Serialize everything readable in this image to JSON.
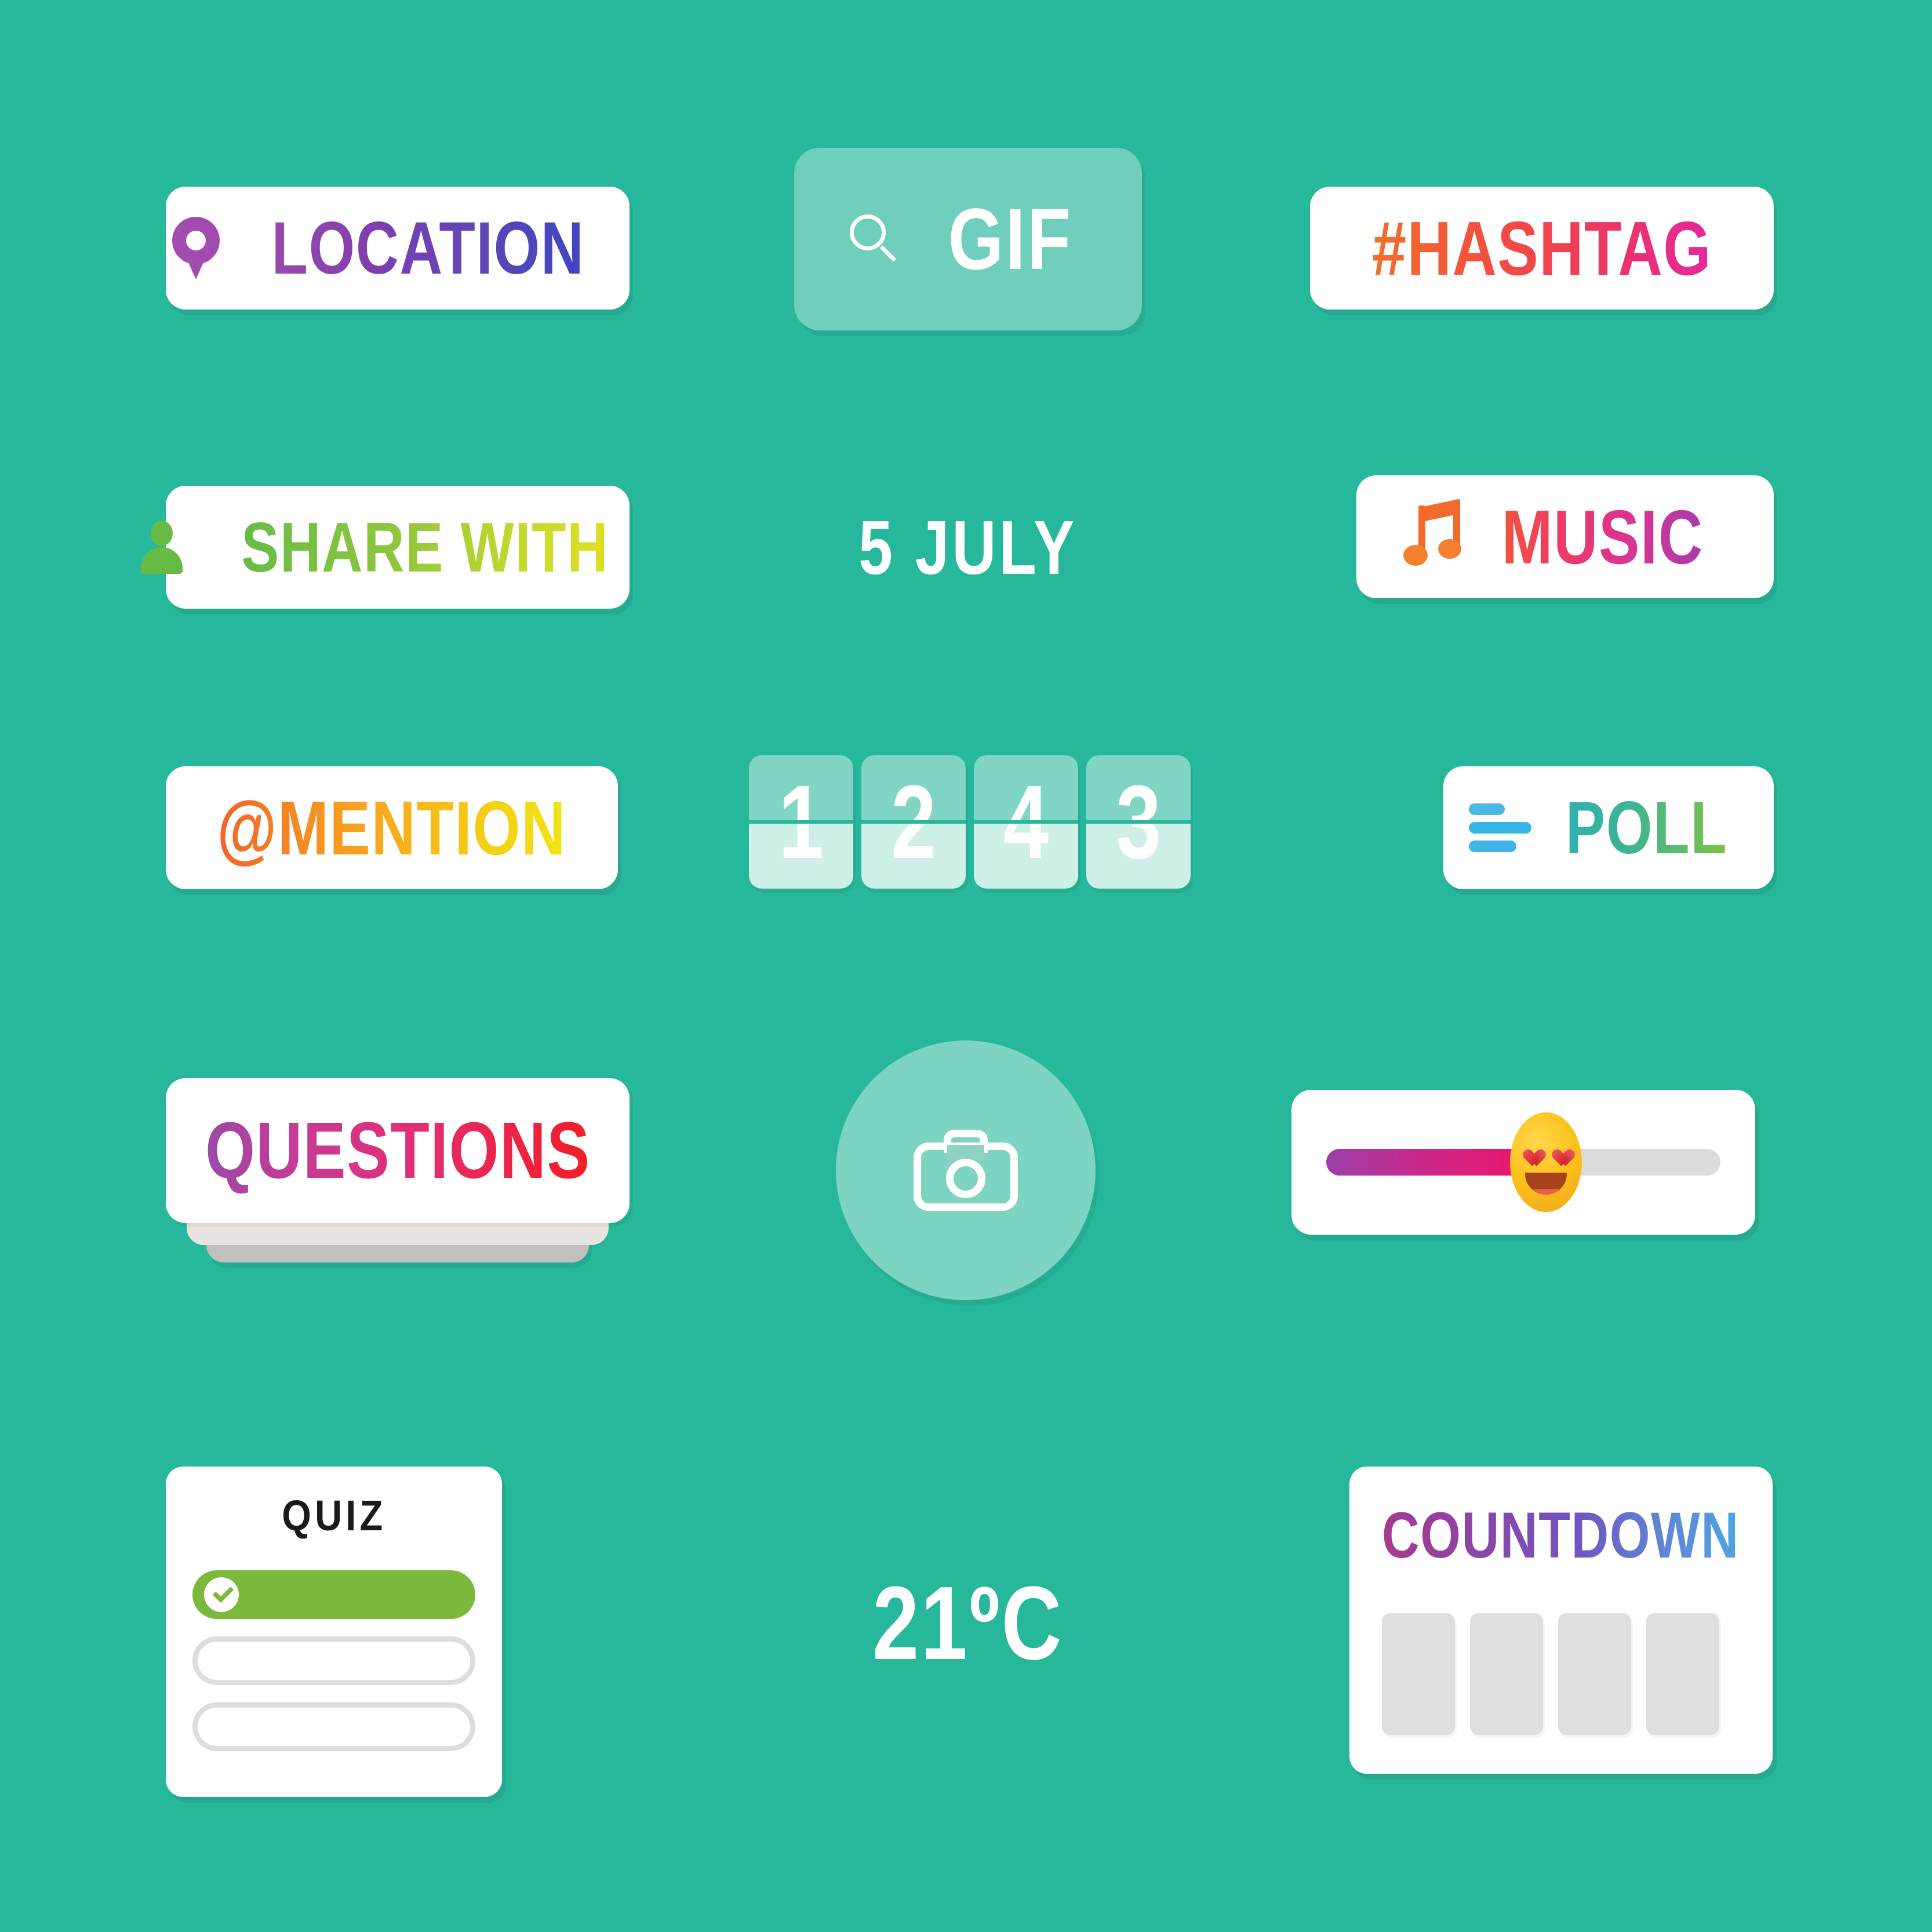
{
  "background_color": "#27b79a",
  "stickers": {
    "location": {
      "label": "LOCATION",
      "icon": "map-pin-icon",
      "gradient_from": "#9a49ab",
      "gradient_to": "#3f45c0"
    },
    "gif": {
      "label": "GIF",
      "icon": "search-icon"
    },
    "hashtag": {
      "label": "#HASHTAG",
      "gradient_from": "#f4702a",
      "gradient_to": "#e6289c"
    },
    "share_with": {
      "label": "SHARE WITH",
      "icon": "person-icon",
      "gradient_from": "#68bb45",
      "gradient_to": "#e2e021"
    },
    "date": {
      "label": "5 JULY"
    },
    "music": {
      "label": "MUSIC",
      "icon": "music-note-icon",
      "gradient_from": "#f2543f",
      "gradient_to": "#a93bab"
    },
    "mention": {
      "label": "@MENTION",
      "gradient_from": "#f2642a",
      "gradient_to": "#f0e516"
    },
    "flip_clock": {
      "digits": [
        "1",
        "2",
        "4",
        "3"
      ]
    },
    "poll": {
      "label": "POLL",
      "icon": "poll-bars-icon",
      "gradient_from": "#30b2ae",
      "gradient_to": "#7fc241",
      "bar_color": "#35b6e5"
    },
    "questions": {
      "label": "QUESTIONS",
      "gradient_from": "#9c4aa8",
      "gradient_to": "#f01f25"
    },
    "camera": {
      "icon": "camera-icon"
    },
    "emoji_slider": {
      "emoji": "heart-eyes-emoji",
      "fill_percent": 46,
      "fill_from": "#9b3fa9",
      "fill_to": "#e8186e",
      "track_color": "#dedcda"
    },
    "quiz": {
      "title": "QUIZ",
      "options": [
        {
          "state": "correct",
          "color": "#7ab93b",
          "icon": "check-icon"
        },
        {
          "state": "empty",
          "color": "#dfdddb"
        },
        {
          "state": "empty",
          "color": "#dfdddb"
        }
      ]
    },
    "temperature": {
      "label": "21ºC"
    },
    "countdown": {
      "label": "COUNTDOWN",
      "gradient_from": "#a6398f",
      "gradient_to": "#4fa3e3",
      "tiles": [
        "",
        "",
        "",
        ""
      ],
      "tile_color": "#e0dfdd"
    }
  }
}
